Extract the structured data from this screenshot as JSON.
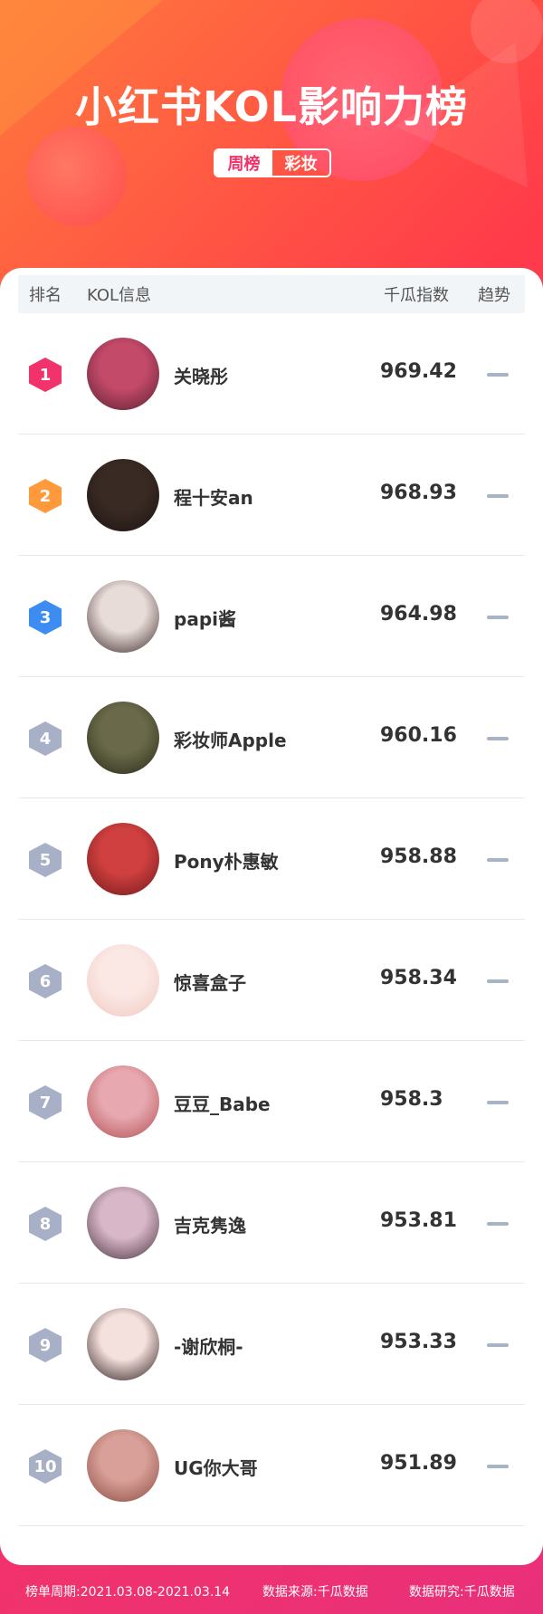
{
  "header": {
    "title": "小红书KOL影响力榜",
    "tabs": [
      {
        "label": "周榜",
        "active": true
      },
      {
        "label": "彩妆",
        "active": false
      }
    ]
  },
  "table": {
    "columns": [
      "排名",
      "KOL信息",
      "千瓜指数",
      "趋势"
    ],
    "rows": [
      {
        "rank": "1",
        "name": "关晓彤",
        "score": "969.42",
        "trend": "flat",
        "badge_color": "#f2326a",
        "avatar_colors": [
          "#c44a6a",
          "#5a2030"
        ]
      },
      {
        "rank": "2",
        "name": "程十安an",
        "score": "968.93",
        "trend": "flat",
        "badge_color": "#ff9a3c",
        "avatar_colors": [
          "#3a2a24",
          "#1a1412"
        ]
      },
      {
        "rank": "3",
        "name": "papi酱",
        "score": "964.98",
        "trend": "flat",
        "badge_color": "#3c8cf2",
        "avatar_colors": [
          "#e8dcd8",
          "#3a2a2a"
        ]
      },
      {
        "rank": "4",
        "name": "彩妆师Apple",
        "score": "960.16",
        "trend": "flat",
        "badge_color": "#a7b0c6",
        "avatar_colors": [
          "#6a6a4a",
          "#2a2a1a"
        ]
      },
      {
        "rank": "5",
        "name": "Pony朴惠敏",
        "score": "958.88",
        "trend": "flat",
        "badge_color": "#a7b0c6",
        "avatar_colors": [
          "#d04040",
          "#701818"
        ]
      },
      {
        "rank": "6",
        "name": "惊喜盒子",
        "score": "958.34",
        "trend": "flat",
        "badge_color": "#a7b0c6",
        "avatar_colors": [
          "#fbe8e4",
          "#f0c8c0"
        ]
      },
      {
        "rank": "7",
        "name": "豆豆_Babe",
        "score": "958.3",
        "trend": "flat",
        "badge_color": "#a7b0c6",
        "avatar_colors": [
          "#e8a8b0",
          "#b05050"
        ]
      },
      {
        "rank": "8",
        "name": "吉克隽逸",
        "score": "953.81",
        "trend": "flat",
        "badge_color": "#a7b0c6",
        "avatar_colors": [
          "#d8b8c8",
          "#4a3040"
        ]
      },
      {
        "rank": "9",
        "name": "-谢欣桐-",
        "score": "953.33",
        "trend": "flat",
        "badge_color": "#a7b0c6",
        "avatar_colors": [
          "#f4e0dc",
          "#2a1a1a"
        ]
      },
      {
        "rank": "10",
        "name": "UG你大哥",
        "score": "951.89",
        "trend": "flat",
        "badge_color": "#a7b0c6",
        "avatar_colors": [
          "#d8a098",
          "#8a4a40"
        ]
      }
    ]
  },
  "footer": {
    "period": "榜单周期:2021.03.08-2021.03.14",
    "source": "数据来源:千瓜数据",
    "research": "数据研究:千瓜数据"
  }
}
